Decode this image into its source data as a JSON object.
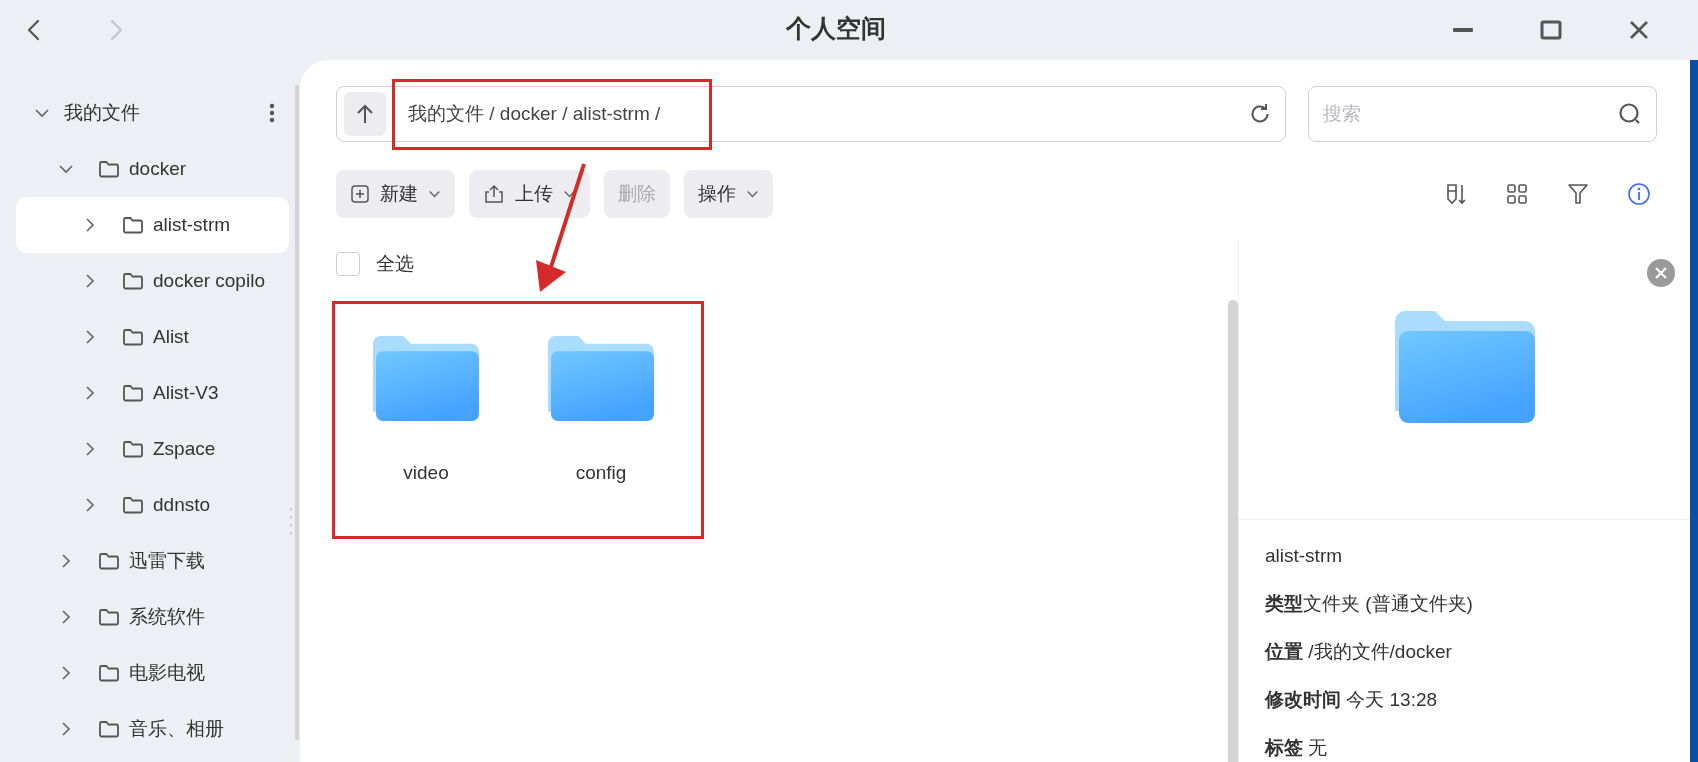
{
  "window": {
    "title": "个人空间"
  },
  "nav_buttons": [
    {
      "kind": "back",
      "disabled": false
    },
    {
      "kind": "forward",
      "disabled": true
    }
  ],
  "sidebar": {
    "tree": [
      {
        "label": "我的文件",
        "expanded": true,
        "selected": false,
        "has_menu": true,
        "children": [
          {
            "label": "docker",
            "expanded": true,
            "selected": false,
            "children": [
              {
                "label": "alist-strm",
                "expanded": false,
                "selected": true
              },
              {
                "label": "docker copilo",
                "expanded": false,
                "selected": false
              },
              {
                "label": "Alist",
                "expanded": false,
                "selected": false
              },
              {
                "label": "Alist-V3",
                "expanded": false,
                "selected": false
              },
              {
                "label": "Zspace",
                "expanded": false,
                "selected": false
              },
              {
                "label": "ddnsto",
                "expanded": false,
                "selected": false
              }
            ]
          },
          {
            "label": "迅雷下载",
            "expanded": false,
            "selected": false
          },
          {
            "label": "系统软件",
            "expanded": false,
            "selected": false
          },
          {
            "label": "电影电视",
            "expanded": false,
            "selected": false
          },
          {
            "label": "音乐、相册",
            "expanded": false,
            "selected": false
          }
        ]
      }
    ]
  },
  "path_bar": {
    "path": "我的文件 / docker / alist-strm /",
    "highlighted": true
  },
  "search": {
    "placeholder": "搜索"
  },
  "toolbar": {
    "buttons": [
      {
        "label": "新建",
        "kind": "new",
        "has_menu": true,
        "disabled": false
      },
      {
        "label": "上传",
        "kind": "upload",
        "has_menu": true,
        "disabled": false
      },
      {
        "label": "删除",
        "kind": "plain",
        "has_menu": false,
        "disabled": true
      },
      {
        "label": "操作",
        "kind": "plain",
        "has_menu": true,
        "disabled": false
      }
    ],
    "view_tools": [
      {
        "kind": "sort",
        "selected": false
      },
      {
        "kind": "grid",
        "selected": false
      },
      {
        "kind": "filter",
        "selected": false
      },
      {
        "kind": "info",
        "selected": true
      }
    ]
  },
  "select_all": {
    "label": "全选",
    "checked": false
  },
  "files": {
    "highlighted": true,
    "items": [
      {
        "name": "video",
        "selected": false
      },
      {
        "name": "config",
        "selected": false
      }
    ]
  },
  "annotation_arrow": true,
  "info_panel": {
    "name": "alist-strm",
    "fields": [
      "**类型**文件夹 (普通文件夹)",
      "**位置** /我的文件/docker",
      "**修改时间** 今天 13:28",
      "**标签** 无"
    ]
  }
}
